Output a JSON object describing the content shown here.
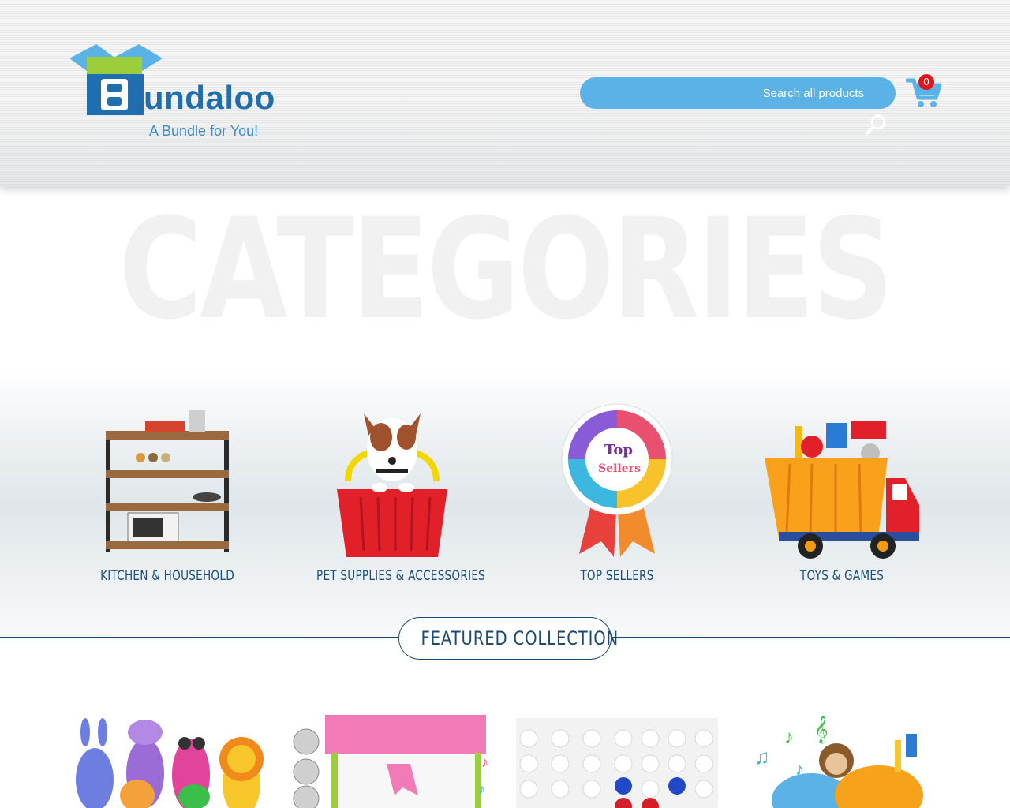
{
  "header": {
    "logo_word": "undaloo",
    "logo_letter": "B",
    "logo_tagline": "A Bundle for You!",
    "search_placeholder": "Search all products",
    "cart_count": "0"
  },
  "background_title": "CATEGORIES",
  "categories": [
    {
      "label": "KITCHEN & HOUSEHOLD",
      "icon": "kitchen-shelf-icon"
    },
    {
      "label": "PET SUPPLIES & ACCESSORIES",
      "icon": "dog-basket-icon"
    },
    {
      "label": "TOP SELLERS",
      "icon": "ribbon-badge-icon"
    },
    {
      "label": "TOYS & GAMES",
      "icon": "toy-truck-icon"
    }
  ],
  "featured": {
    "label": "FEATURED COLLECTION"
  },
  "products": [
    {
      "icon": "animal-bowling-pins-image"
    },
    {
      "icon": "claw-machine-image"
    },
    {
      "icon": "connect-four-image"
    },
    {
      "icon": "musical-car-toy-image"
    }
  ],
  "colors": {
    "search_bg": "#5bb2e6",
    "brand_blue": "#1f6fb0",
    "navy": "#1d4a70",
    "badge_red": "#e0161c"
  }
}
